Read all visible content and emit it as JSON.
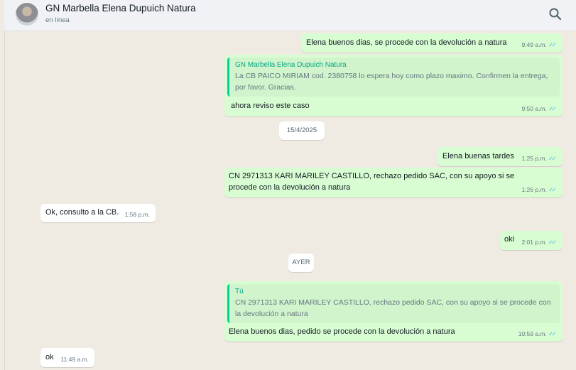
{
  "header": {
    "contact_name": "GN Marbella Elena Dupuich Natura",
    "status": "en línea",
    "search_icon": "search-icon"
  },
  "messages": [
    {
      "type": "out",
      "text": "Elena buenos dias, se procede con la devolución a natura",
      "time": "9:49 a.m.",
      "read": true
    },
    {
      "type": "out",
      "quote_author": "GN Marbella Elena Dupuich Natura",
      "quote_text": "La CB PAICO MIRIAM cod. 2380758 lo espera hoy como plazo maximo. Confirmen la entrega, por favor. Gracias.",
      "text": "ahora reviso este caso",
      "time": "9:50 a.m.",
      "read": true
    },
    {
      "type": "date",
      "text": "15/4/2025"
    },
    {
      "type": "out",
      "text": "Elena buenas tardes",
      "time": "1:25 p.m.",
      "read": true
    },
    {
      "type": "out",
      "text": "CN 2971313 KARI MARILEY CASTILLO, rechazo pedido SAC, con su apoyo si se procede con la devolución a natura",
      "time": "1:26 p.m.",
      "read": true
    },
    {
      "type": "in",
      "text": "Ok, consulto a la CB.",
      "time": "1:58 p.m."
    },
    {
      "type": "out",
      "text": "oki",
      "time": "2:01 p.m.",
      "read": true
    },
    {
      "type": "date",
      "text": "AYER"
    },
    {
      "type": "out",
      "quote_author": "Tú",
      "quote_text": "CN 2971313 KARI MARILEY CASTILLO, rechazo pedido SAC, con su apoyo si se procede con la devolución a natura",
      "text": "Elena buenos dias, pedido se procede con la devolución a natura",
      "time": "10:59 a.m.",
      "read": true
    },
    {
      "type": "in",
      "text": "ok",
      "time": "11:49 a.m."
    }
  ],
  "read_ticks": "✓✓"
}
